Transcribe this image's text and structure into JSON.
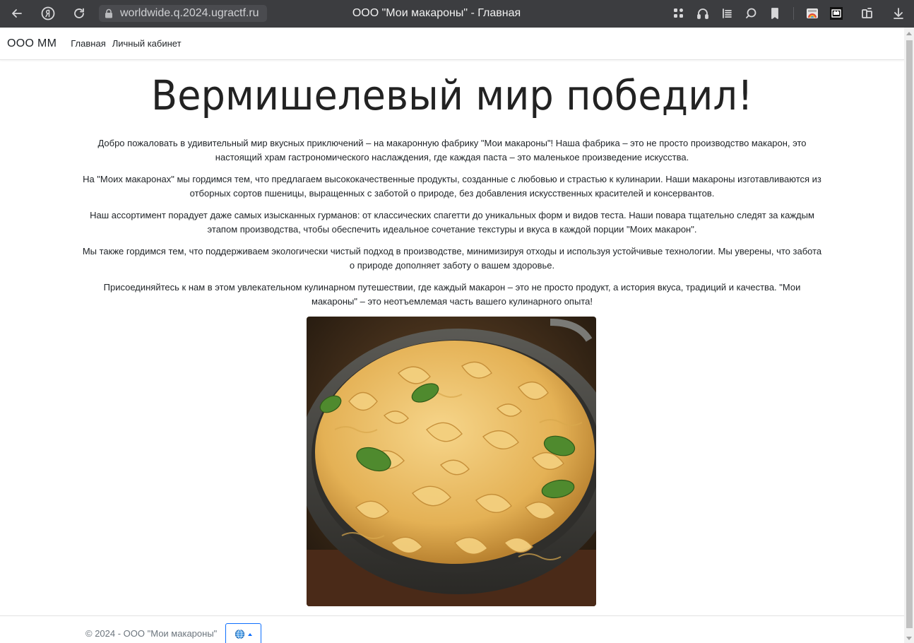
{
  "browser": {
    "url": "worldwide.q.2024.ugractf.ru",
    "tab_title": "ООО \"Мои макароны\" - Главная"
  },
  "navbar": {
    "brand": "ООО ММ",
    "links": [
      "Главная",
      "Личный кабинет"
    ]
  },
  "main": {
    "heading": "Вермишелевый мир победил!",
    "paragraphs": [
      "Добро пожаловать в удивительный мир вкусных приключений – на макаронную фабрику \"Мои макароны\"! Наша фабрика – это не просто производство макарон, это настоящий храм гастрономического наслаждения, где каждая паста – это маленькое произведение искусства.",
      "На \"Моих макаронах\" мы гордимся тем, что предлагаем высококачественные продукты, созданные с любовью и страстью к кулинарии. Наши макароны изготавливаются из отборных сортов пшеницы, выращенных с заботой о природе, без добавления искусственных красителей и консервантов.",
      "Наш ассортимент порадует даже самых изысканных гурманов: от классических спагетти до уникальных форм и видов теста. Наши повара тщательно следят за каждым этапом производства, чтобы обеспечить идеальное сочетание текстуры и вкуса в каждой порции \"Моих макарон\".",
      "Мы также гордимся тем, что поддерживаем экологически чистый подход в производстве, минимизируя отходы и используя устойчивые технологии. Мы уверены, что забота о природе дополняет заботу о вашем здоровье.",
      "Присоединяйтесь к нам в этом увлекательном кулинарном путешествии, где каждый макарон – это не просто продукт, а история вкуса, традиций и качества. \"Мои макароны\" – это неотъемлемая часть вашего кулинарного опыта!"
    ]
  },
  "footer": {
    "copyright": "© 2024 - ООО \"Мои макароны\""
  },
  "colors": {
    "chrome_bg": "#3c3d40",
    "accent": "#0d6efd",
    "pasta": "#e8b85a",
    "basil": "#4f8a2e",
    "pan": "#3a3a38"
  },
  "icons": [
    "back-arrow-icon",
    "yandex-icon",
    "reload-icon",
    "lock-icon",
    "apps-icon",
    "headphones-icon",
    "reader-icon",
    "chat-icon",
    "bookmark-icon",
    "gallery-icon",
    "extension-icon",
    "collections-icon",
    "download-icon",
    "globe-icon"
  ]
}
